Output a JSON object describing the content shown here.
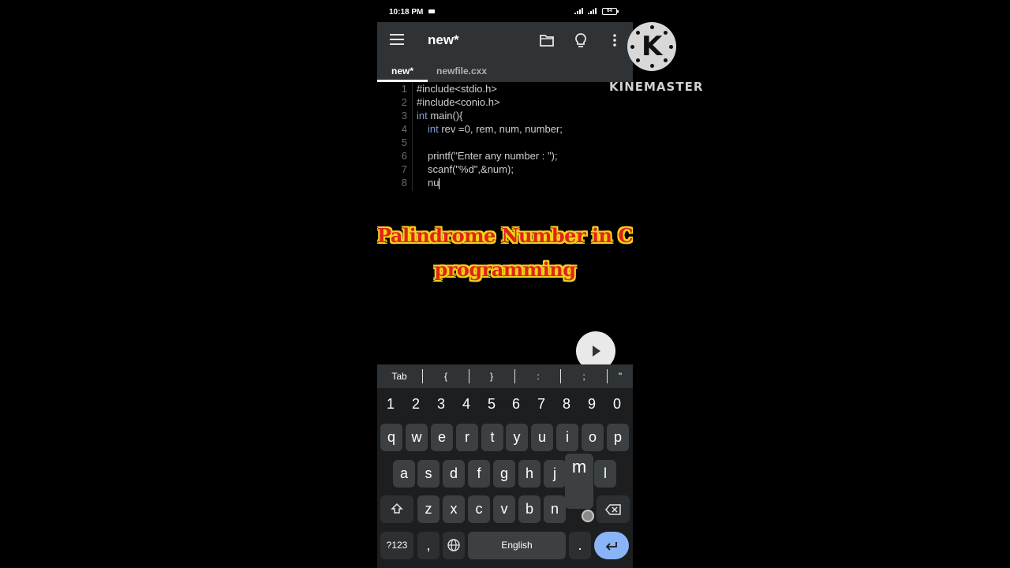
{
  "status": {
    "time": "10:18 PM",
    "battery": "64"
  },
  "appbar": {
    "title": "new*",
    "icons": [
      "menu-icon",
      "folder-icon",
      "lightbulb-icon",
      "more-vert-icon"
    ]
  },
  "tabs": [
    {
      "label": "new*",
      "active": true
    },
    {
      "label": "newfile.cxx",
      "active": false
    }
  ],
  "editor": {
    "line_numbers": [
      "1",
      "2",
      "3",
      "4",
      "5",
      "6",
      "7",
      "8"
    ],
    "lines": {
      "l1": "#include<stdio.h>",
      "l2": "#include<conio.h>",
      "l3_kw": "int",
      "l3_rest": " main(){",
      "l4_kw": "int",
      "l4_rest": " rev =0, rem, num, number;",
      "l6": "printf(\"Enter any number : \");",
      "l7": "scanf(\"%d\",&num);",
      "l8": "nu"
    }
  },
  "overlay": {
    "line1": "Palindrome Number in C",
    "line2": "programming"
  },
  "symbols": [
    "Tab",
    "{",
    "}",
    ":",
    ";",
    "\""
  ],
  "keyboard": {
    "numbers": [
      "1",
      "2",
      "3",
      "4",
      "5",
      "6",
      "7",
      "8",
      "9",
      "0"
    ],
    "row1": [
      "q",
      "w",
      "e",
      "r",
      "t",
      "y",
      "u",
      "i",
      "o",
      "p"
    ],
    "row2": [
      "a",
      "s",
      "d",
      "f",
      "g",
      "h",
      "j",
      "k",
      "l"
    ],
    "row3": [
      "z",
      "x",
      "c",
      "v",
      "b",
      "n",
      "m"
    ],
    "popup": "m",
    "sym_key": "?123",
    "comma": ",",
    "space": "English",
    "period": "."
  },
  "watermark": {
    "logo_letter": "K",
    "brand": "KINEMASTER"
  },
  "colors": {
    "appbar": "#2f3335",
    "keyword": "#7fa0d6",
    "overlay_fill": "#e0241a",
    "overlay_outline": "#f5d21a",
    "enter_key": "#8ab4f8"
  }
}
